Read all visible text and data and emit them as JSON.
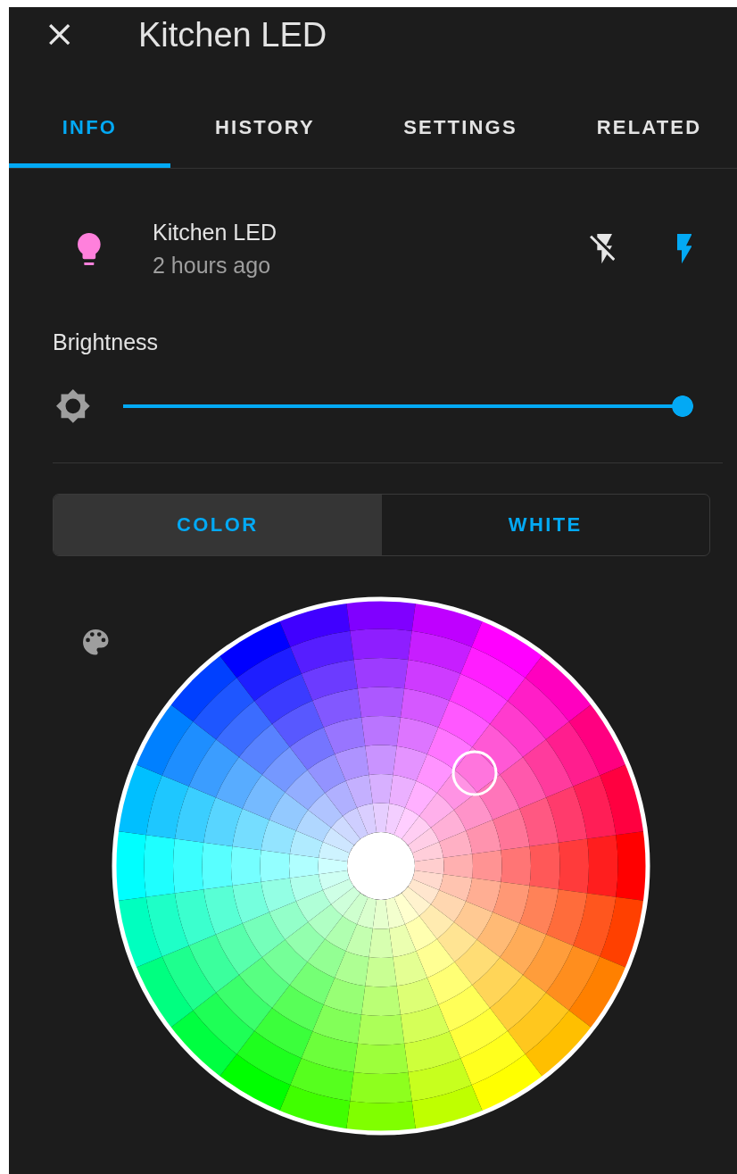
{
  "dialog": {
    "title": "Kitchen LED"
  },
  "tabs": [
    {
      "label": "INFO",
      "selected": true
    },
    {
      "label": "HISTORY",
      "selected": false
    },
    {
      "label": "SETTINGS",
      "selected": false
    },
    {
      "label": "RELATED",
      "selected": false
    }
  ],
  "entity": {
    "name": "Kitchen LED",
    "last_changed": "2 hours ago",
    "on": true
  },
  "brightness": {
    "label": "Brightness",
    "level": 1
  },
  "color_modes": [
    {
      "label": "COLOR",
      "selected": true
    },
    {
      "label": "WHITE",
      "selected": false
    }
  ]
}
